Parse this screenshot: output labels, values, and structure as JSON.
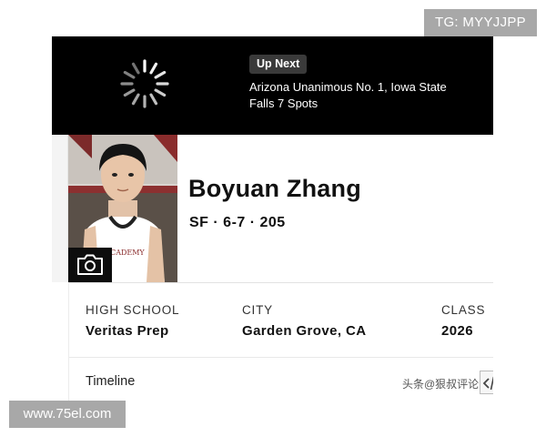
{
  "overlays": {
    "top_tag": "TG: MYYJJPP",
    "site_tag": "www.75el.com",
    "cn_watermark": "头条@狠叔评论"
  },
  "up_next": {
    "badge": "Up Next",
    "headline_line1": "Arizona Unanimous No. 1, Iowa State",
    "headline_line2": "Falls 7 Spots"
  },
  "player": {
    "name": "Boyuan Zhang",
    "meta": "SF · 6-7 · 205",
    "photo_icon": "camera-icon"
  },
  "info": {
    "high_school_label": "HIGH SCHOOL",
    "high_school_value": "Veritas Prep",
    "city_label": "CITY",
    "city_value": "Garden Grove, CA",
    "class_label": "CLASS",
    "class_value": "2026"
  },
  "timeline": {
    "label": "Timeline",
    "icon": "code-icon"
  },
  "colors": {
    "bar_background": "#000000",
    "badge_background": "#3a3a3a",
    "tag_background": "#a8a8a8"
  }
}
